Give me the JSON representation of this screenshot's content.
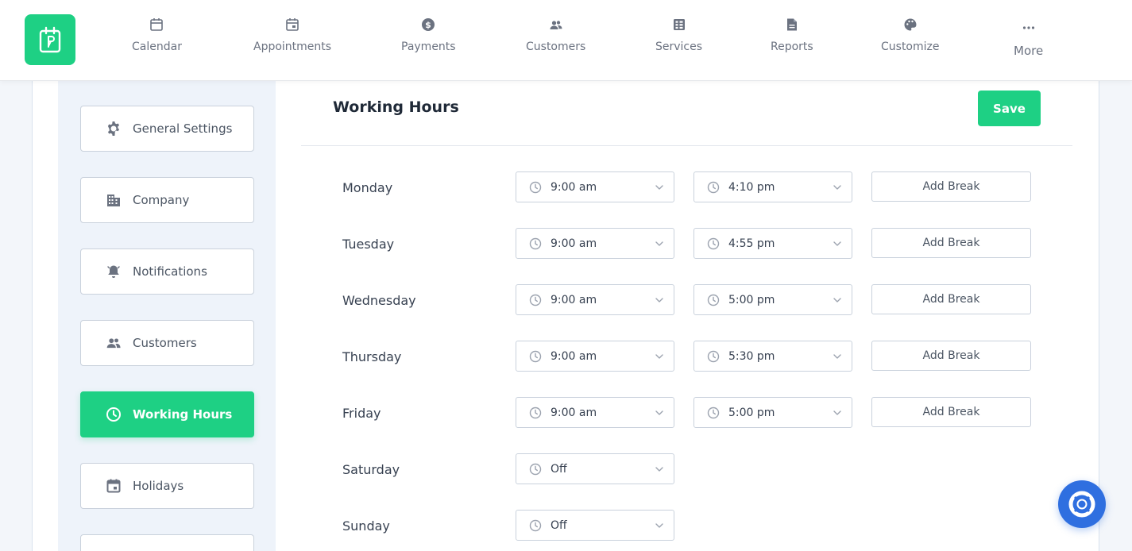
{
  "nav": {
    "items": [
      {
        "label": "Calendar",
        "icon": "calendar-icon"
      },
      {
        "label": "Appointments",
        "icon": "calendar-check-icon"
      },
      {
        "label": "Payments",
        "icon": "dollar-icon"
      },
      {
        "label": "Customers",
        "icon": "users-icon"
      },
      {
        "label": "Services",
        "icon": "grid-icon"
      },
      {
        "label": "Reports",
        "icon": "document-icon"
      },
      {
        "label": "Customize",
        "icon": "palette-icon"
      },
      {
        "label": "More",
        "icon": "more-icon"
      }
    ]
  },
  "sidebar": {
    "items": [
      {
        "label": "General Settings",
        "icon": "gear-icon"
      },
      {
        "label": "Company",
        "icon": "building-icon"
      },
      {
        "label": "Notifications",
        "icon": "bell-icon"
      },
      {
        "label": "Customers",
        "icon": "users-icon"
      },
      {
        "label": "Working Hours",
        "icon": "clock-icon",
        "active": true
      },
      {
        "label": "Holidays",
        "icon": "calendar-icon"
      }
    ]
  },
  "panel": {
    "title": "Working Hours",
    "save_label": "Save",
    "add_break_label": "Add Break"
  },
  "schedule": [
    {
      "day": "Monday",
      "start": "9:00 am",
      "end": "4:10 pm"
    },
    {
      "day": "Tuesday",
      "start": "9:00 am",
      "end": "4:55 pm"
    },
    {
      "day": "Wednesday",
      "start": "9:00 am",
      "end": "5:00 pm"
    },
    {
      "day": "Thursday",
      "start": "9:00 am",
      "end": "5:30 pm"
    },
    {
      "day": "Friday",
      "start": "9:00 am",
      "end": "5:00 pm"
    },
    {
      "day": "Saturday",
      "start": "Off"
    },
    {
      "day": "Sunday",
      "start": "Off"
    }
  ],
  "colors": {
    "accent": "#1ed084",
    "help": "#2f6fe0"
  }
}
